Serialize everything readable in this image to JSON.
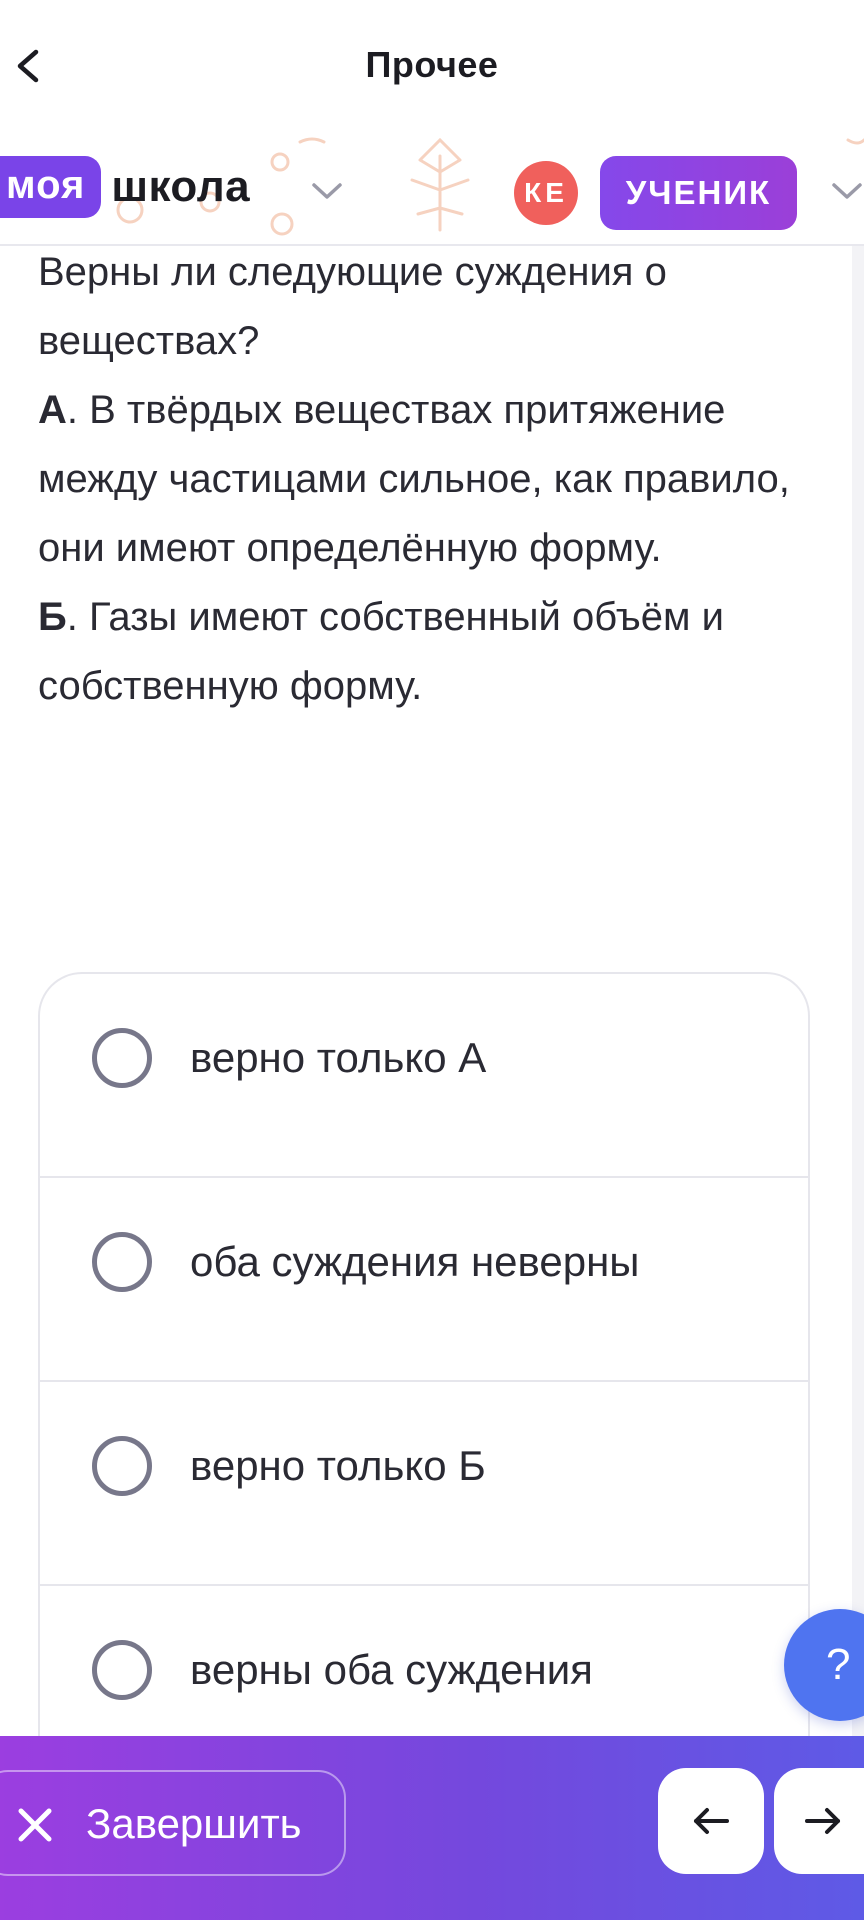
{
  "nav": {
    "title": "Прочее",
    "back_icon": "chevron-left-icon"
  },
  "header": {
    "logo_part1": "моя",
    "logo_part2": "школа",
    "avatar_initials": "КЕ",
    "role": "УЧЕНИК",
    "colors": {
      "brand": "#7a44e8",
      "avatar": "#f0605c"
    }
  },
  "question": {
    "intro": "Верны ли следующие суждения о веществах?",
    "statements": [
      {
        "label": "А",
        "text": ". В твёрдых веществах притяжение между частицами сильное, как правило, они имеют определённую форму."
      },
      {
        "label": "Б",
        "text": ". Газы имеют собственный объём и собственную форму."
      }
    ]
  },
  "options": [
    {
      "label": "верно только А",
      "selected": false
    },
    {
      "label": "оба суждения неверны",
      "selected": false
    },
    {
      "label": "верно только Б",
      "selected": false
    },
    {
      "label": "верны оба суждения",
      "selected": false
    }
  ],
  "help": {
    "label": "?"
  },
  "footer": {
    "finish_label": "Завершить",
    "prev_icon": "arrow-left-icon",
    "next_icon": "arrow-right-icon",
    "colors": {
      "gradient_start": "#9b3ee0",
      "gradient_end": "#5e5ae6"
    }
  }
}
